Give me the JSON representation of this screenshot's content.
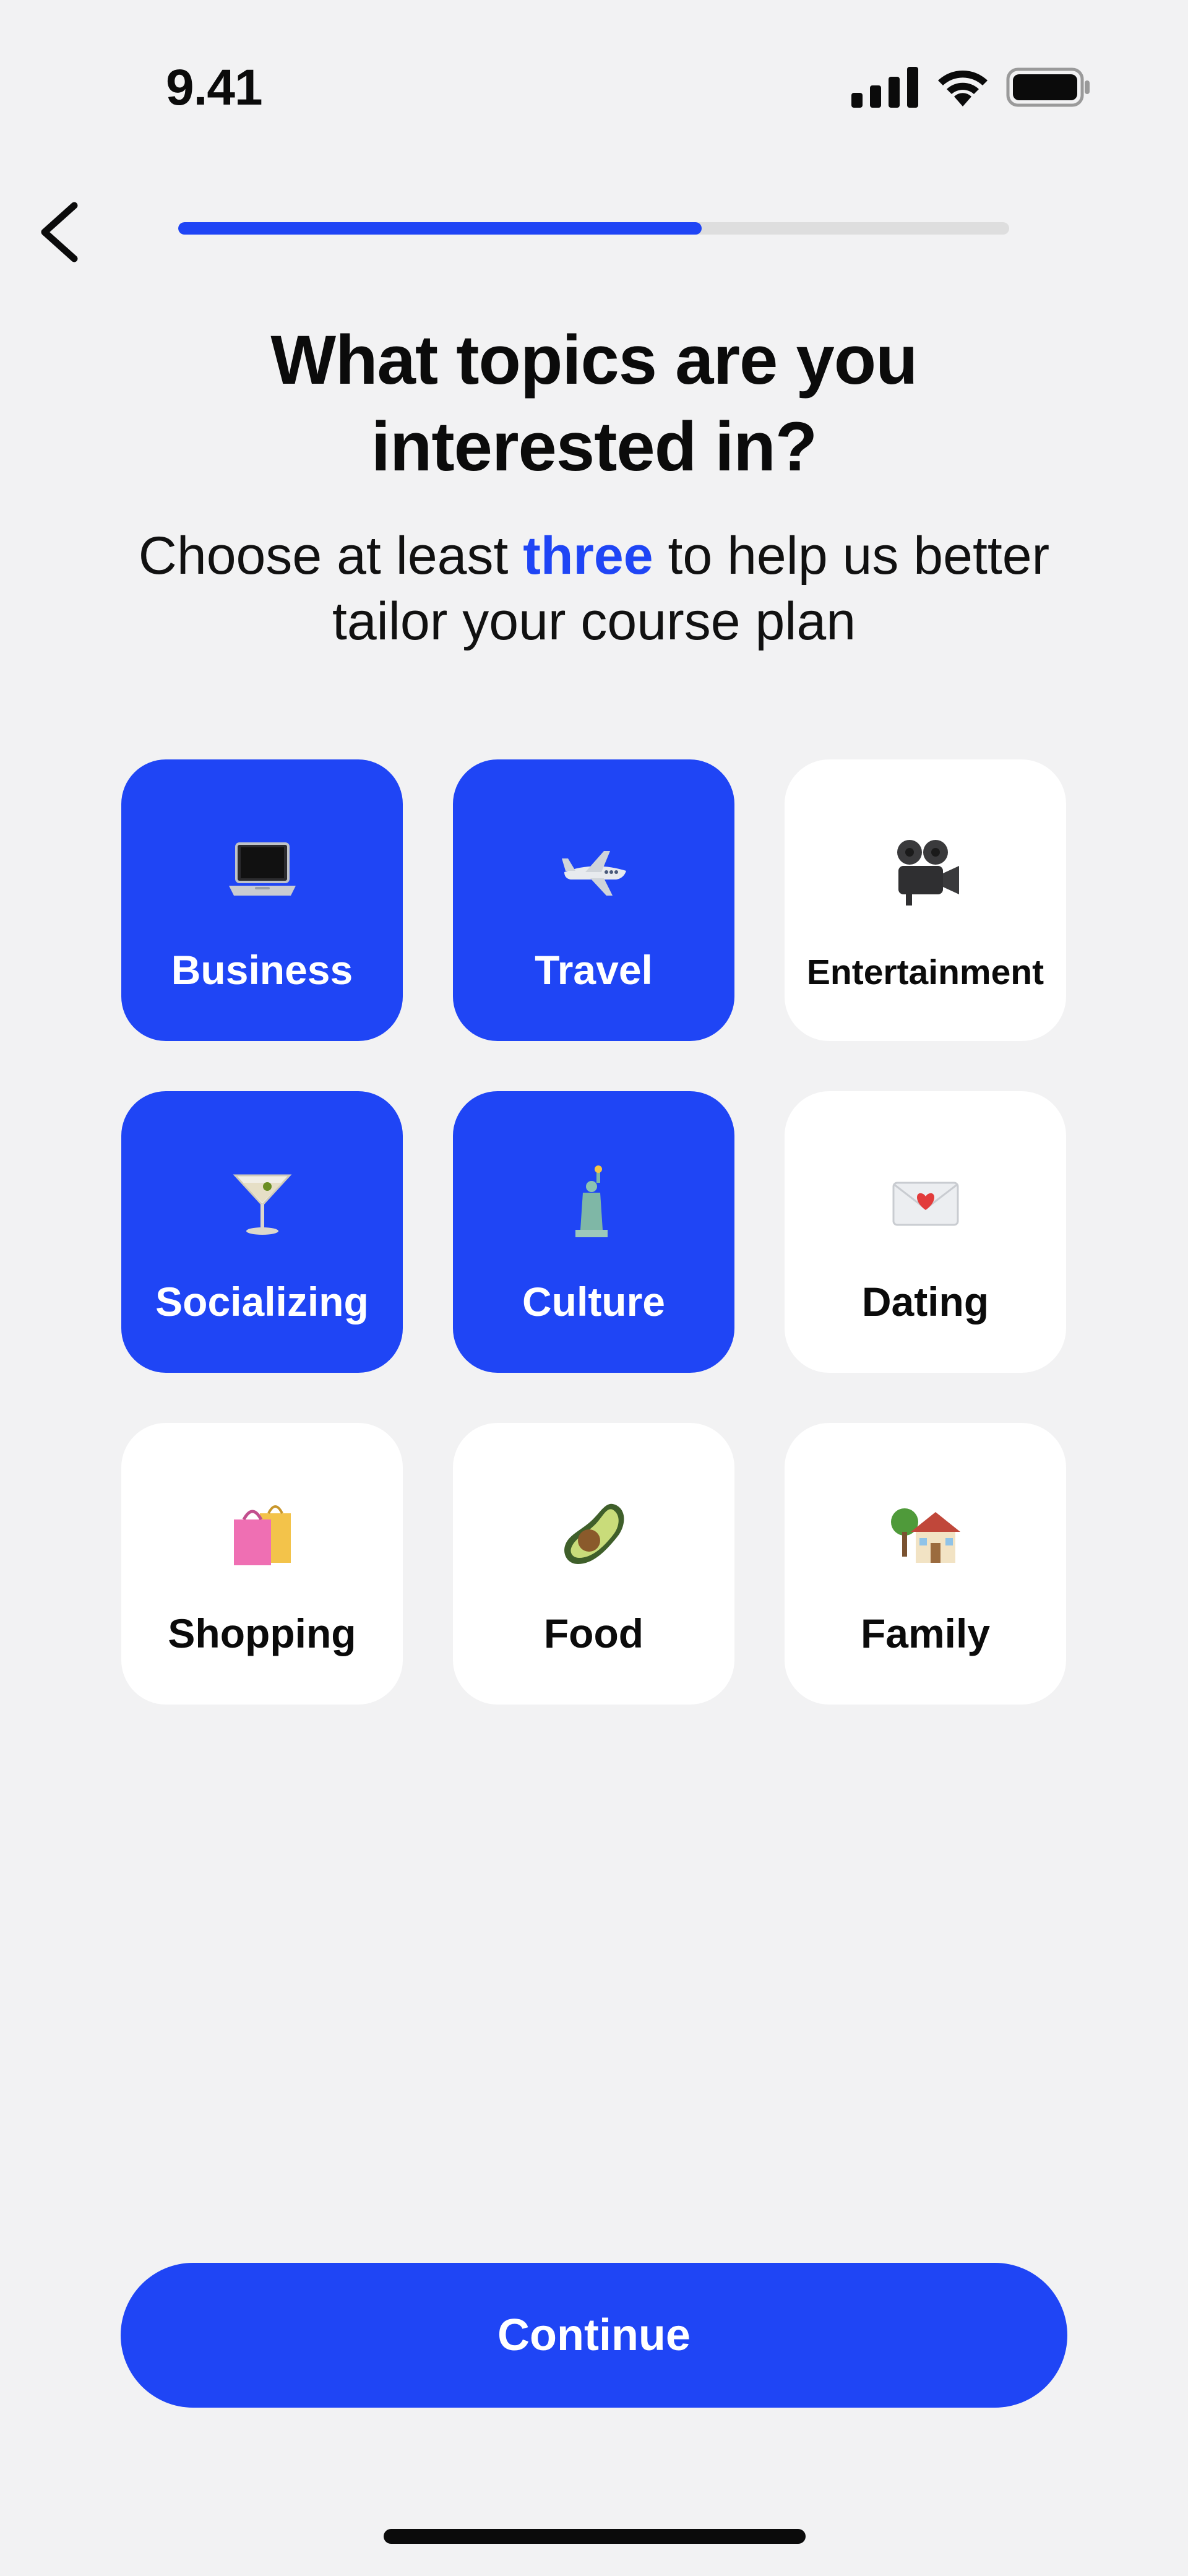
{
  "status_bar": {
    "time": "9.41",
    "icons": [
      "cellular-signal-icon",
      "wifi-icon",
      "battery-icon"
    ]
  },
  "nav": {
    "back_icon": "chevron-left-icon",
    "progress_fraction": 0.63
  },
  "heading": {
    "title": "What topics are you interested in?",
    "subtitle_before": "Choose at least ",
    "subtitle_highlight": "three",
    "subtitle_after": " to help us better tailor your course plan"
  },
  "topics": [
    {
      "label": "Business",
      "icon": "laptop-icon",
      "selected": true
    },
    {
      "label": "Travel",
      "icon": "airplane-icon",
      "selected": true
    },
    {
      "label": "Entertainment",
      "icon": "movie-camera-icon",
      "selected": false
    },
    {
      "label": "Socializing",
      "icon": "cocktail-glass-icon",
      "selected": true
    },
    {
      "label": "Culture",
      "icon": "statue-of-liberty-icon",
      "selected": true
    },
    {
      "label": "Dating",
      "icon": "love-letter-icon",
      "selected": false
    },
    {
      "label": "Shopping",
      "icon": "shopping-bags-icon",
      "selected": false
    },
    {
      "label": "Food",
      "icon": "avocado-icon",
      "selected": false
    },
    {
      "label": "Family",
      "icon": "house-with-garden-icon",
      "selected": false
    }
  ],
  "continue_label": "Continue",
  "colors": {
    "accent": "#1f45f5",
    "background": "#f2f2f3",
    "card": "#ffffff",
    "track": "#dedede"
  }
}
